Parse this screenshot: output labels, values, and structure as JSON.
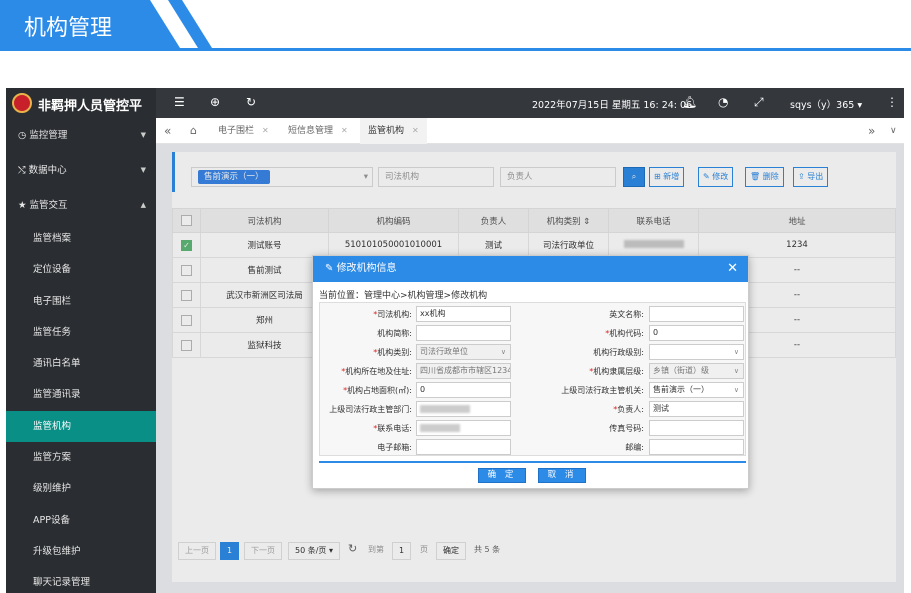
{
  "banner": {
    "title": "机构管理"
  },
  "app": {
    "title": "非羁押人员管控平",
    "datetime": "2022年07月15日 星期五 16: 24: 06",
    "user": "sqys（y）365 ▾"
  },
  "sidebar": {
    "items": [
      {
        "label": "监控管理",
        "caret": "▼"
      },
      {
        "label": "数据中心",
        "caret": "▼"
      },
      {
        "label": "监管交互",
        "caret": "▲"
      },
      {
        "label": "监管档案"
      },
      {
        "label": "定位设备"
      },
      {
        "label": "电子围栏"
      },
      {
        "label": "监管任务"
      },
      {
        "label": "通讯白名单"
      },
      {
        "label": "监管通讯录"
      },
      {
        "label": "监管机构"
      },
      {
        "label": "监管方案"
      },
      {
        "label": "级别维护"
      },
      {
        "label": "APP设备"
      },
      {
        "label": "升级包维护"
      },
      {
        "label": "聊天记录管理"
      }
    ]
  },
  "tabs": [
    {
      "label": "电子围栏"
    },
    {
      "label": "短信息管理"
    },
    {
      "label": "监管机构"
    }
  ],
  "filter": {
    "select_value": "售前演示（一）",
    "org_placeholder": "司法机构",
    "person_placeholder": "负责人",
    "btn_add": "新增",
    "btn_edit": "修改",
    "btn_delete": "删除",
    "btn_export": "导出"
  },
  "table": {
    "headers": [
      "司法机构",
      "机构编码",
      "负责人",
      "机构类别 ⇕",
      "联系电话",
      "地址"
    ],
    "rows": [
      {
        "org": "测试账号",
        "code": "510101050001010001",
        "person": "测试",
        "type": "司法行政单位",
        "addr": "1234",
        "checked": true
      },
      {
        "org": "售前测试",
        "code": "",
        "person": "",
        "type": "",
        "addr": "--",
        "checked": false
      },
      {
        "org": "武汉市新洲区司法局",
        "code": "",
        "person": "",
        "type": "",
        "addr": "--",
        "checked": false
      },
      {
        "org": "郑州",
        "code": "",
        "person": "",
        "type": "",
        "addr": "--",
        "checked": false
      },
      {
        "org": "监狱科技",
        "code": "",
        "person": "",
        "type": "",
        "addr": "--",
        "checked": false
      }
    ]
  },
  "pager": {
    "prev": "上一页",
    "page": "1",
    "next": "下一页",
    "size": "50 条/页 ▾",
    "goto": "到第",
    "goto_val": "1",
    "page_unit": "页",
    "confirm": "确定",
    "total": "共 5 条"
  },
  "modal": {
    "title": "修改机构信息",
    "crumb": "当前位置：管理中心>机构管理>修改机构",
    "fields": {
      "org_label": "司法机构:",
      "org_value": "xx机构",
      "en_label": "英文名称:",
      "en_value": "",
      "short_label": "机构简称:",
      "short_value": "",
      "code_label": "机构代码:",
      "code_value": "0",
      "type_label": "机构类别:",
      "type_value": "司法行政单位",
      "level_label": "机构行政级别:",
      "level_value": "",
      "addr_label": "机构所在地及住址:",
      "addr_value": "四川省成都市市辖区1234",
      "belong_label": "机构隶属层级:",
      "belong_value": "乡镇（街道）级",
      "area_label": "机构占地面积(㎡):",
      "area_value": "0",
      "parent_label": "上级司法行政主管机关:",
      "parent_value": "售前演示（一）",
      "dept_label": "上级司法行政主管部门:",
      "person_label": "负责人:",
      "person_value": "测试",
      "phone_label": "联系电话:",
      "fax_label": "传真号码:",
      "fax_value": "",
      "email_label": "电子邮箱:",
      "email_value": "",
      "mail_label": "邮编:",
      "mail_value": ""
    },
    "ok": "确 定",
    "cancel": "取 消"
  },
  "colors": {
    "accent": "#2d8be8",
    "sidebar": "#2a2d31",
    "active": "#0a8f86"
  }
}
